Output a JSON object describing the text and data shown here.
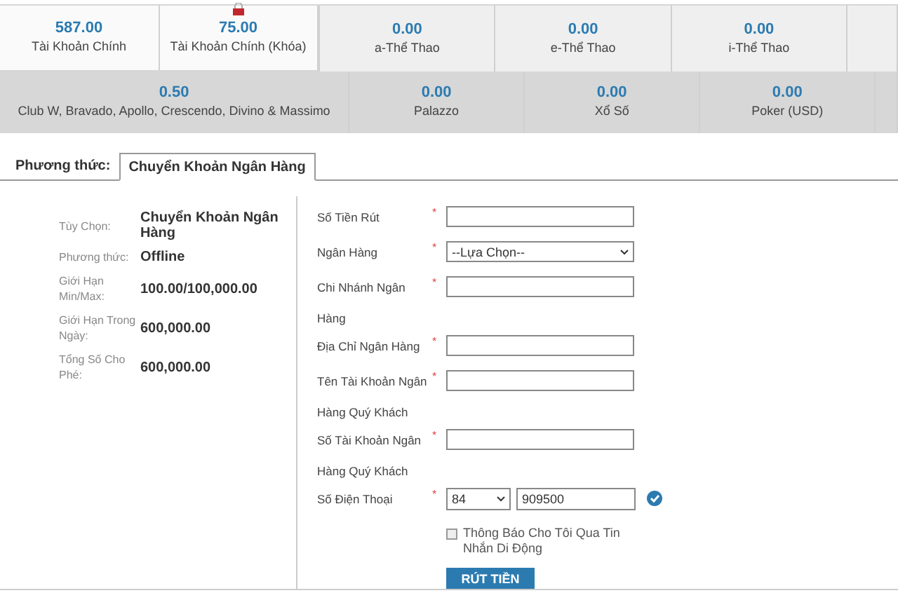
{
  "main_accounts": [
    {
      "amount": "587.00",
      "label": "Tài Khoản Chính",
      "locked": false
    },
    {
      "amount": "75.00",
      "label": "Tài Khoản Chính (Khóa)",
      "locked": true
    }
  ],
  "wallets": [
    {
      "amount": "0.00",
      "label": "a-Thể Thao"
    },
    {
      "amount": "0.00",
      "label": "e-Thể Thao"
    },
    {
      "amount": "0.00",
      "label": "i-Thể Thao"
    }
  ],
  "other_wallets": [
    {
      "amount": "0.50",
      "label": "Club W, Bravado, Apollo, Crescendo, Divino & Massimo"
    },
    {
      "amount": "0.00",
      "label": "Palazzo"
    },
    {
      "amount": "0.00",
      "label": "Xổ Số"
    },
    {
      "amount": "0.00",
      "label": "Poker (USD)"
    }
  ],
  "method_label": "Phương thức:",
  "method_tabs": [
    {
      "label": "Chuyển Khoản Ngân Hàng",
      "selected": true
    }
  ],
  "info": [
    {
      "label": "Tùy Chọn:",
      "value": "Chuyển Khoản Ngân Hàng"
    },
    {
      "label": "Phương thức:",
      "value": "Offline"
    },
    {
      "label": "Giới Hạn Min/Max:",
      "value": "100.00/100,000.00"
    },
    {
      "label": "Giới Hạn Trong Ngày:",
      "value": "600,000.00"
    },
    {
      "label": "Tổng Số Cho Phé:",
      "value": "600,000.00"
    }
  ],
  "fields": [
    {
      "kind": "text",
      "label": "Số Tiền Rút",
      "required_mark": "*"
    },
    {
      "kind": "select",
      "label": "Ngân Hàng",
      "required_mark": "*",
      "value": "--Lựa Chọn--"
    },
    {
      "kind": "text",
      "label": "Chi Nhánh Ngân Hàng",
      "required_mark": "*"
    },
    {
      "kind": "text",
      "label": "Địa Chỉ Ngân Hàng",
      "required_mark": "*"
    },
    {
      "kind": "text",
      "label": "Tên Tài Khoản Ngân Hàng Quý Khách",
      "required_mark": "*"
    },
    {
      "kind": "text",
      "label": "Số Tài Khoản Ngân Hàng Quý Khách",
      "required_mark": "*"
    },
    {
      "kind": "phone",
      "label": "Số Điện Thoại",
      "required_mark": "*",
      "country_code": "84",
      "value": "909500",
      "verified": true
    }
  ],
  "sms_option": {
    "label": "Thông Báo Cho Tôi Qua Tin Nhắn Di Động",
    "checked": false
  },
  "submit": "RÚT TIỀN"
}
